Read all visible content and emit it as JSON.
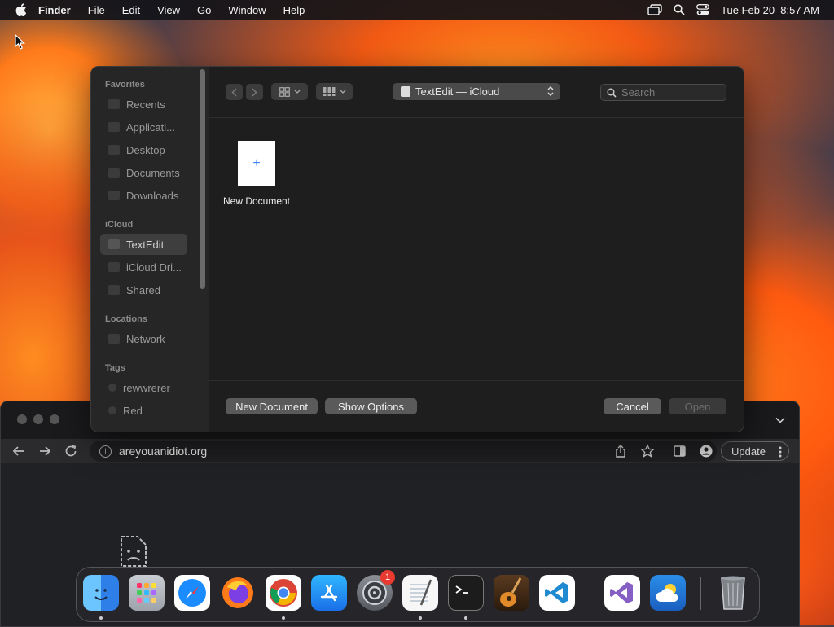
{
  "menubar": {
    "app_name": "Finder",
    "menus": [
      "File",
      "Edit",
      "View",
      "Go",
      "Window",
      "Help"
    ],
    "datetime": "Tue Feb 20  8:57 AM"
  },
  "dialog": {
    "sidebar": {
      "sections": [
        {
          "title": "Favorites",
          "items": [
            "Recents",
            "Applicati...",
            "Desktop",
            "Documents",
            "Downloads"
          ]
        },
        {
          "title": "iCloud",
          "items": [
            "TextEdit",
            "iCloud Dri...",
            "Shared"
          ]
        },
        {
          "title": "Locations",
          "items": [
            "Network"
          ]
        },
        {
          "title": "Tags",
          "items": [
            "rewwrerer",
            "Red"
          ]
        }
      ],
      "selected_item": "TextEdit"
    },
    "location": "TextEdit — iCloud",
    "search": {
      "placeholder": "Search"
    },
    "files": [
      {
        "name": "New Document",
        "thumb_glyph": "+"
      }
    ],
    "buttons": {
      "new_document": "New Document",
      "show_options": "Show Options",
      "cancel": "Cancel",
      "open": "Open"
    }
  },
  "browser": {
    "url": "areyouanidiot.org",
    "update_label": "Update"
  },
  "dock": {
    "apps": [
      "finder-icon",
      "launchpad-icon",
      "safari-icon",
      "firefox-icon",
      "chrome-icon",
      "app-store-icon",
      "system-settings-icon",
      "textedit-icon",
      "terminal-icon",
      "garageband-icon",
      "vscode-icon",
      "visual-studio-icon",
      "weather-icon",
      "trash-icon"
    ],
    "settings_badge": "1"
  },
  "colors": {
    "accent": "#3b82f6",
    "badge": "#e83a30",
    "wallpaper_orange": "#ff6a1a",
    "wallpaper_blue": "#1c3556"
  }
}
